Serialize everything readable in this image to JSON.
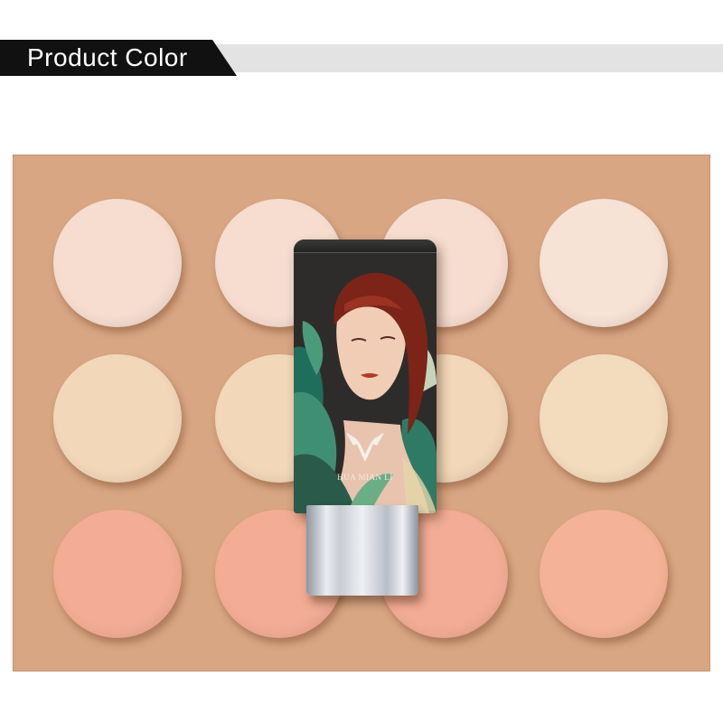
{
  "header": {
    "title": "Product Color"
  },
  "product": {
    "brand_text": "HUA MIAN LI",
    "icon": "brand-logo-icon"
  },
  "swatches": [
    {
      "row": 1,
      "color": "#f6ddd0"
    },
    {
      "row": 1,
      "color": "#f6ddd0"
    },
    {
      "row": 1,
      "color": "#f6ddd0"
    },
    {
      "row": 1,
      "color": "#f7e2d6"
    },
    {
      "row": 2,
      "color": "#f2d8b9"
    },
    {
      "row": 2,
      "color": "#f2d8b9"
    },
    {
      "row": 2,
      "color": "#f2d8b9"
    },
    {
      "row": 2,
      "color": "#f3dcbd"
    },
    {
      "row": 3,
      "color": "#f3ad96"
    },
    {
      "row": 3,
      "color": "#f3ad96"
    },
    {
      "row": 3,
      "color": "#f3ad96"
    },
    {
      "row": 3,
      "color": "#f4b398"
    }
  ],
  "colors": {
    "background": "#d8a683",
    "banner": "#111111",
    "banner_grey": "#e3e3e3"
  }
}
